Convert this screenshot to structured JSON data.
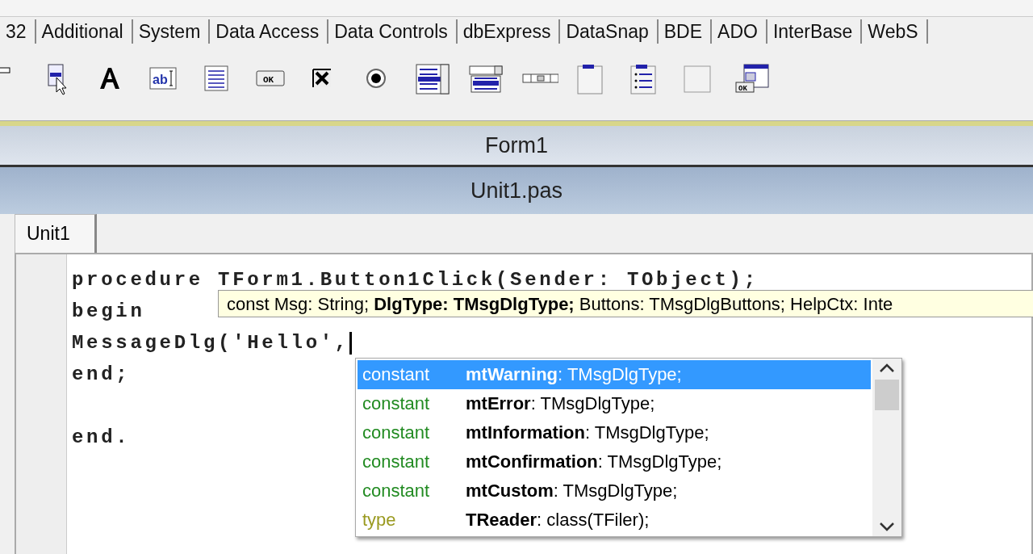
{
  "palette_tabs": [
    {
      "label": "32"
    },
    {
      "label": "Additional"
    },
    {
      "label": "System"
    },
    {
      "label": "Data Access"
    },
    {
      "label": "Data Controls"
    },
    {
      "label": "dbExpress"
    },
    {
      "label": "DataSnap"
    },
    {
      "label": "BDE"
    },
    {
      "label": "ADO"
    },
    {
      "label": "InterBase"
    },
    {
      "label": "WebS"
    }
  ],
  "palette_icons": [
    {
      "kind": "frame"
    },
    {
      "kind": "menu"
    },
    {
      "kind": "label"
    },
    {
      "kind": "edit",
      "caption": "ab"
    },
    {
      "kind": "memo"
    },
    {
      "kind": "button",
      "caption": "OK"
    },
    {
      "kind": "checkbox"
    },
    {
      "kind": "radio"
    },
    {
      "kind": "listbox"
    },
    {
      "kind": "combobox"
    },
    {
      "kind": "scrollbar"
    },
    {
      "kind": "groupbox"
    },
    {
      "kind": "radiogroup"
    },
    {
      "kind": "panel"
    },
    {
      "kind": "actionlist",
      "caption": "OK"
    }
  ],
  "form_window": {
    "title": "Form1"
  },
  "editor_window": {
    "title": "Unit1.pas"
  },
  "editor_tabs": [
    {
      "label": "Unit1",
      "selected": true
    }
  ],
  "code_lines": [
    {
      "text": "procedure TForm1.Button1Click(Sender: TObject);",
      "blank_line_before": false
    },
    {
      "text": "begin",
      "blank_line_before": false
    },
    {
      "text": "MessageDlg('Hello',",
      "blank_line_before": false
    },
    {
      "text": "end;",
      "blank_line_before": false
    },
    {
      "text": "end.",
      "blank_line_before": true
    }
  ],
  "parameter_hint": "const Msg: String; **DlgType: TMsgDlgType;** Buttons: TMsgDlgButtons; HelpCtx: Inte",
  "completion_items": [
    {
      "kind": "constant",
      "category": "constant",
      "name": "mtWarning",
      "type": " : TMsgDlgType;",
      "selected": true
    },
    {
      "kind": "constant",
      "category": "constant",
      "name": "mtError",
      "type": " : TMsgDlgType;",
      "selected": false
    },
    {
      "kind": "constant",
      "category": "constant",
      "name": "mtInformation",
      "type": " : TMsgDlgType;",
      "selected": false
    },
    {
      "kind": "constant",
      "category": "constant",
      "name": "mtConfirmation",
      "type": " : TMsgDlgType;",
      "selected": false
    },
    {
      "kind": "constant",
      "category": "constant",
      "name": "mtCustom",
      "type": " : TMsgDlgType;",
      "selected": false
    },
    {
      "kind": "type",
      "category": "type",
      "name": "TReader",
      "type": " : class(TFiler);",
      "selected": false
    }
  ]
}
